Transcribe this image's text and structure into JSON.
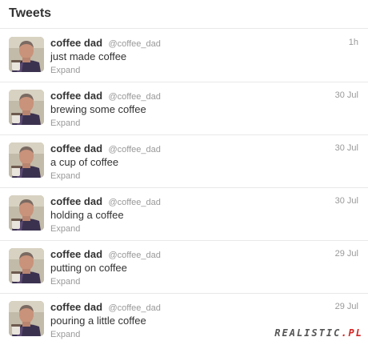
{
  "header": {
    "title": "Tweets"
  },
  "tweets": [
    {
      "fullname": "coffee dad",
      "username": "@coffee_dad",
      "time": "1h",
      "text": "just made coffee",
      "expand": "Expand"
    },
    {
      "fullname": "coffee dad",
      "username": "@coffee_dad",
      "time": "30 Jul",
      "text": "brewing some coffee",
      "expand": "Expand"
    },
    {
      "fullname": "coffee dad",
      "username": "@coffee_dad",
      "time": "30 Jul",
      "text": "a cup of coffee",
      "expand": "Expand"
    },
    {
      "fullname": "coffee dad",
      "username": "@coffee_dad",
      "time": "30 Jul",
      "text": "holding a coffee",
      "expand": "Expand"
    },
    {
      "fullname": "coffee dad",
      "username": "@coffee_dad",
      "time": "29 Jul",
      "text": "putting on coffee",
      "expand": "Expand"
    },
    {
      "fullname": "coffee dad",
      "username": "@coffee_dad",
      "time": "29 Jul",
      "text": "pouring a little coffee",
      "expand": "Expand"
    }
  ],
  "watermark": {
    "main": "REALISTIC",
    "accent": ".PL"
  },
  "colors": {
    "text": "#333333",
    "muted": "#999999",
    "divider": "#e8e8e8",
    "watermark_accent": "#d42323"
  }
}
